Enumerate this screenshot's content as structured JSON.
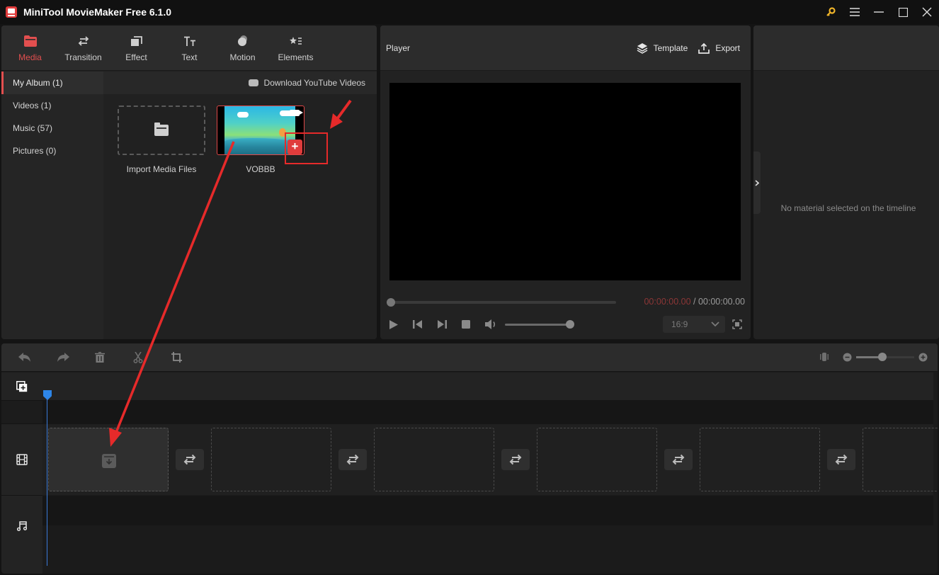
{
  "window": {
    "title": "MiniTool MovieMaker Free 6.1.0",
    "controls": [
      "key-icon",
      "menu-icon",
      "minimize-icon",
      "maximize-icon",
      "close-icon"
    ]
  },
  "toolbar": {
    "tabs": [
      {
        "label": "Media",
        "icon": "folder-icon",
        "active": true
      },
      {
        "label": "Transition",
        "icon": "transition-icon",
        "active": false
      },
      {
        "label": "Effect",
        "icon": "effect-icon",
        "active": false
      },
      {
        "label": "Text",
        "icon": "text-icon",
        "active": false
      },
      {
        "label": "Motion",
        "icon": "motion-icon",
        "active": false
      },
      {
        "label": "Elements",
        "icon": "elements-icon",
        "active": false
      }
    ],
    "accent": "#e34f4f"
  },
  "media": {
    "sidebar": [
      {
        "label": "My Album (1)",
        "active": true
      },
      {
        "label": "Videos (1)",
        "active": false
      },
      {
        "label": "Music (57)",
        "active": false
      },
      {
        "label": "Pictures (0)",
        "active": false
      }
    ],
    "download_label": "Download YouTube Videos",
    "import_label": "Import Media Files",
    "clip": {
      "label": "VOBBB",
      "add_label": "+"
    }
  },
  "player": {
    "title": "Player",
    "template_label": "Template",
    "export_label": "Export",
    "current_time": "00:00:00.00",
    "separator": " / ",
    "total_time": "00:00:00.00",
    "progress": 0,
    "volume": 1.0,
    "aspect_ratio": "16:9"
  },
  "properties": {
    "empty_message": "No material selected on the timeline"
  },
  "timeline": {
    "tools": [
      "undo-icon",
      "redo-icon",
      "delete-icon",
      "split-icon",
      "crop-icon"
    ],
    "zoom_level": 0.45,
    "video_slots": 6,
    "transitions": 5,
    "tracks": [
      "video-track-icon",
      "audio-track-icon"
    ]
  },
  "annotation_color": "#e62a2a"
}
